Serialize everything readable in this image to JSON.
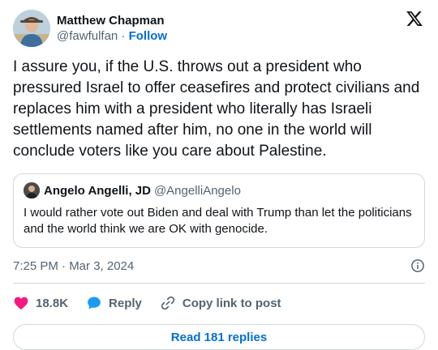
{
  "author": {
    "name": "Matthew Chapman",
    "handle": "@fawfulfan",
    "separator": "·",
    "follow_label": "Follow"
  },
  "tweet": {
    "text": "I assure you, if the U.S. throws out a president who pressured Israel to offer ceasefires and protect civilians and replaces him with a president who literally has Israeli settlements named after him, no one in the world will conclude voters like you care about Palestine."
  },
  "quote": {
    "name": "Angelo Angelli, JD",
    "handle": "@AngelliAngelo",
    "text": "I would rather vote out Biden and deal with Trump than let the politicians and the world think we are OK with genocide."
  },
  "meta": {
    "timestamp": "7:25 PM · Mar 3, 2024"
  },
  "actions": {
    "likes": "18.8K",
    "reply_label": "Reply",
    "copy_label": "Copy link to post"
  },
  "replies_button": "Read 181 replies",
  "colors": {
    "link_blue": "#006fd6",
    "heart_pink": "#f91880",
    "reply_blue": "#1d9bf0",
    "muted": "#536471"
  },
  "icons": [
    "x-logo-icon",
    "info-icon",
    "heart-icon",
    "reply-bubble-icon",
    "link-icon"
  ]
}
